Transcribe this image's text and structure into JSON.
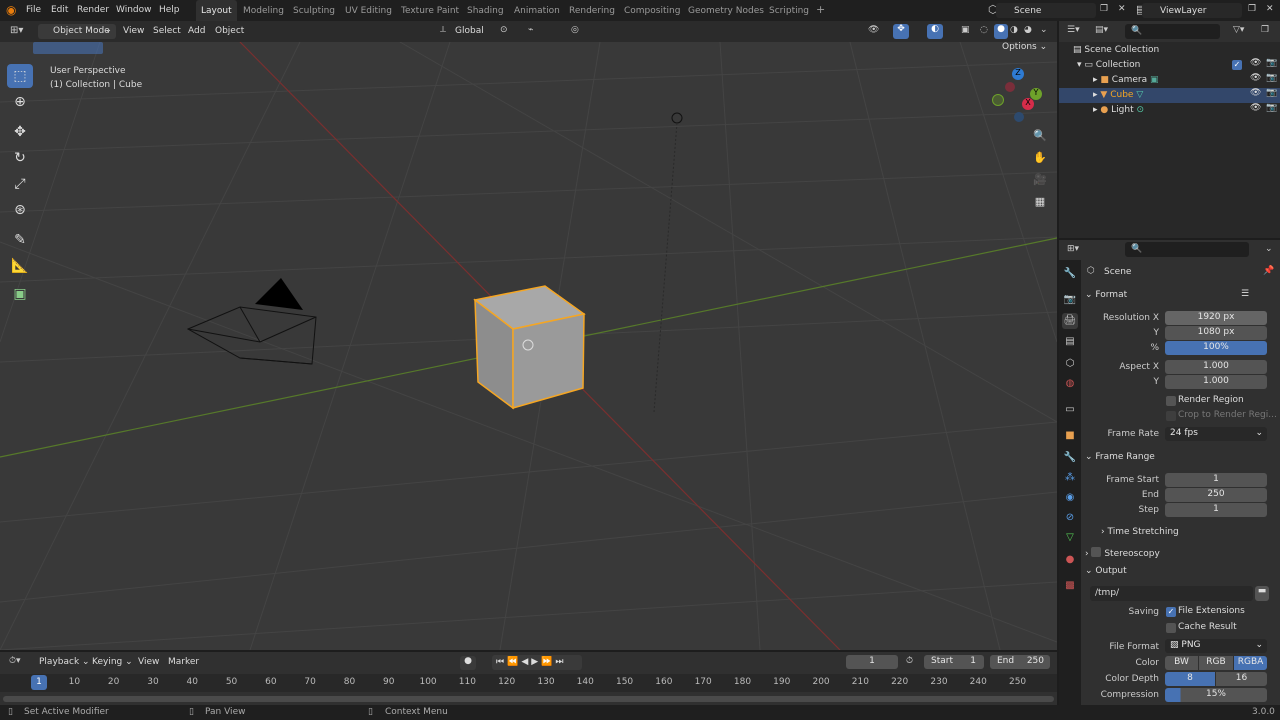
{
  "menu": [
    "File",
    "Edit",
    "Render",
    "Window",
    "Help"
  ],
  "workspaces": [
    "Layout",
    "Modeling",
    "Sculpting",
    "UV Editing",
    "Texture Paint",
    "Shading",
    "Animation",
    "Rendering",
    "Compositing",
    "Geometry Nodes",
    "Scripting",
    "+"
  ],
  "scene_field": "Scene",
  "viewlayer_field": "ViewLayer",
  "viewport_header": {
    "mode": "Object Mode",
    "view": "View",
    "select": "Select",
    "add": "Add",
    "object": "Object",
    "orientation": "Global",
    "options": "Options"
  },
  "viewport_overlay": {
    "line1": "User Perspective",
    "line2": "(1) Collection | Cube"
  },
  "gizmo": {
    "z": "Z",
    "x": "X",
    "y": "Y"
  },
  "outliner": {
    "scene_collection": "Scene Collection",
    "collection": "Collection",
    "camera": "Camera",
    "cube": "Cube",
    "light": "Light"
  },
  "props": {
    "context": "Scene",
    "format": "Format",
    "res_x_label": "Resolution X",
    "res_x": "1920 px",
    "res_y_label": "Y",
    "res_y": "1080 px",
    "pct_label": "%",
    "pct": "100%",
    "aspect_x_label": "Aspect X",
    "aspect_x": "1.000",
    "aspect_y_label": "Y",
    "aspect_y": "1.000",
    "render_region": "Render Region",
    "crop_region": "Crop to Render Regi...",
    "frame_rate_label": "Frame Rate",
    "frame_rate": "24 fps",
    "frame_range": "Frame Range",
    "frame_start_label": "Frame Start",
    "frame_start": "1",
    "end_label": "End",
    "end": "250",
    "step_label": "Step",
    "step": "1",
    "time_stretching": "Time Stretching",
    "stereoscopy": "Stereoscopy",
    "output": "Output",
    "output_path": "/tmp/",
    "saving_label": "Saving",
    "file_extensions": "File Extensions",
    "cache_result": "Cache Result",
    "file_format_label": "File Format",
    "file_format": "PNG",
    "color_label": "Color",
    "color_bw": "BW",
    "color_rgb": "RGB",
    "color_rgba": "RGBA",
    "depth_label": "Color Depth",
    "depth_8": "8",
    "depth_16": "16",
    "compression_label": "Compression",
    "compression": "15%"
  },
  "timeline": {
    "playback": "Playback",
    "keying": "Keying",
    "view": "View",
    "marker": "Marker",
    "current_frame": "1",
    "start_label": "Start",
    "start": "1",
    "end_label": "End",
    "end": "250",
    "ticks": [
      "1",
      "10",
      "20",
      "30",
      "40",
      "50",
      "60",
      "70",
      "80",
      "90",
      "100",
      "110",
      "120",
      "130",
      "140",
      "150",
      "160",
      "170",
      "180",
      "190",
      "200",
      "210",
      "220",
      "230",
      "240",
      "250"
    ]
  },
  "status": {
    "left": "Set Active Modifier",
    "mid": "Pan View",
    "right": "Context Menu",
    "version": "3.0.0"
  },
  "colors": {
    "accent": "#4772b3",
    "selection": "#f5a623",
    "x_axis": "#a33a3a",
    "y_axis": "#6b9b2a"
  }
}
